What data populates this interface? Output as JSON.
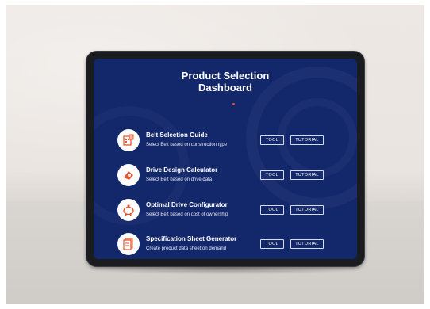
{
  "dashboard": {
    "title_line1": "Product Selection",
    "title_line2": "Dashboard"
  },
  "items": [
    {
      "icon": "belt-guide-icon",
      "title": "Belt Selection Guide",
      "subtitle": "Select Belt based on construction type",
      "tool_label": "TOOL",
      "tutorial_label": "TUTORIAL"
    },
    {
      "icon": "calculator-icon",
      "title": "Drive Design Calculator",
      "subtitle": "Select Belt based on drive data",
      "tool_label": "TOOL",
      "tutorial_label": "TUTORIAL"
    },
    {
      "icon": "piggy-bank-icon",
      "title": "Optimal Drive Configurator",
      "subtitle": "Select Belt based on cost of ownership",
      "tool_label": "TOOL",
      "tutorial_label": "TUTORIAL"
    },
    {
      "icon": "spec-sheet-icon",
      "title": "Specification Sheet Generator",
      "subtitle": "Create product data sheet on demand",
      "tool_label": "TOOL",
      "tutorial_label": "TUTORIAL"
    }
  ],
  "colors": {
    "screen_bg": "#13276b",
    "accent": "#e8542e",
    "text": "#ffffff"
  }
}
